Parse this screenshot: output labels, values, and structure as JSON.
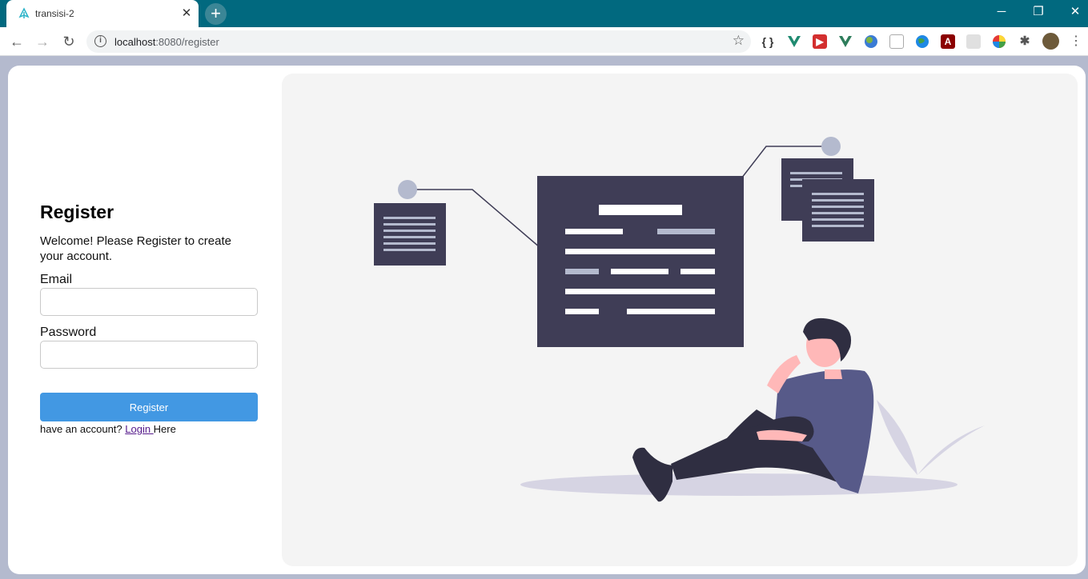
{
  "browser": {
    "tab_title": "transisi-2",
    "new_tab_label": "+",
    "url_host": "localhost",
    "url_rest": ":8080/register",
    "window_controls": [
      "minimize-icon",
      "restore-icon",
      "close-icon"
    ],
    "extensions": [
      "json-viewer-icon",
      "vue-devtools-icon",
      "media-icon",
      "vue-icon",
      "globe-icon",
      "notes-icon",
      "earth-icon",
      "pdf-icon",
      "dots-icon",
      "color-wheel-icon",
      "puzzle-icon",
      "profile-avatar-icon"
    ]
  },
  "form": {
    "title": "Register",
    "subtitle": "Welcome! Please Register to create your account.",
    "email_label": "Email",
    "email_value": "",
    "password_label": "Password",
    "password_value": "",
    "submit_label": "Register",
    "footer_prefix": "have an account? ",
    "login_link": "Login ",
    "footer_suffix": "Here"
  },
  "colors": {
    "accent": "#4298e3",
    "chrome": "#01697f",
    "illustration_dark": "#3f3d56",
    "illustration_light": "#b4bace"
  }
}
